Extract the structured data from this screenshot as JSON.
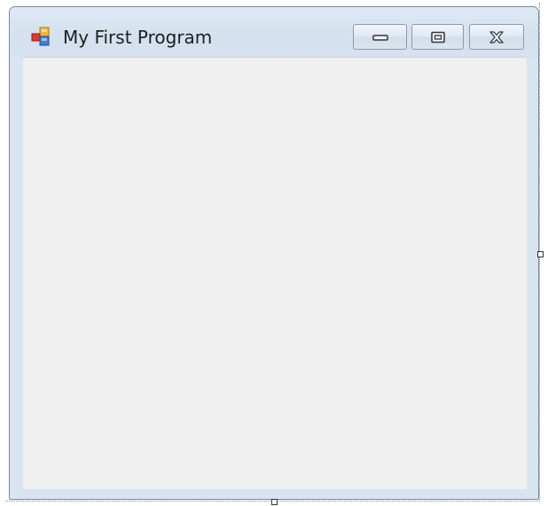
{
  "window": {
    "title": "My First Program",
    "icon": "form-app-icon",
    "colors": {
      "frame": "#d8e4f0",
      "client_area": "#f0f0f0",
      "border": "#7a8796"
    }
  },
  "caption_buttons": {
    "minimize_icon": "minimize-icon",
    "maximize_icon": "maximize-icon",
    "close_icon": "close-icon"
  },
  "designer": {
    "resize_handles": [
      "right-middle",
      "bottom-middle"
    ]
  }
}
